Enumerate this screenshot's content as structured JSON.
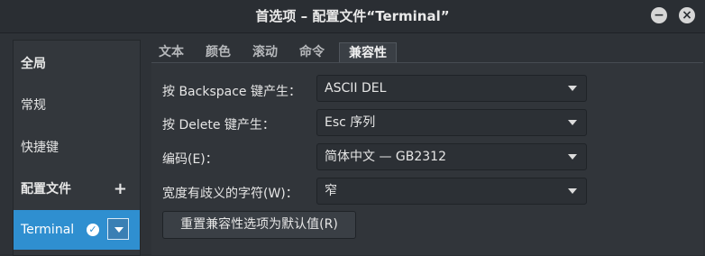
{
  "window": {
    "title": "首选项 – 配置文件“Terminal”"
  },
  "controls": {
    "minimize": "−",
    "close": "×"
  },
  "sidebar": {
    "items": [
      {
        "label": "全局"
      },
      {
        "label": "常规"
      },
      {
        "label": "快捷键"
      },
      {
        "label": "配置文件",
        "action": "+"
      },
      {
        "label": "Terminal",
        "check": "✓"
      }
    ]
  },
  "tabs": [
    "文本",
    "颜色",
    "滚动",
    "命令",
    "兼容性"
  ],
  "compat": {
    "rows": [
      {
        "label": "按 Backspace 键产生：",
        "value": "ASCII DEL"
      },
      {
        "label": "按 Delete 键产生：",
        "value": "Esc 序列"
      },
      {
        "label": "编码(E)：",
        "value": "简体中文 — GB2312"
      },
      {
        "label": "宽度有歧义的字符(W)：",
        "value": "窄"
      }
    ],
    "reset_button": "重置兼容性选项为默认值(R)"
  }
}
